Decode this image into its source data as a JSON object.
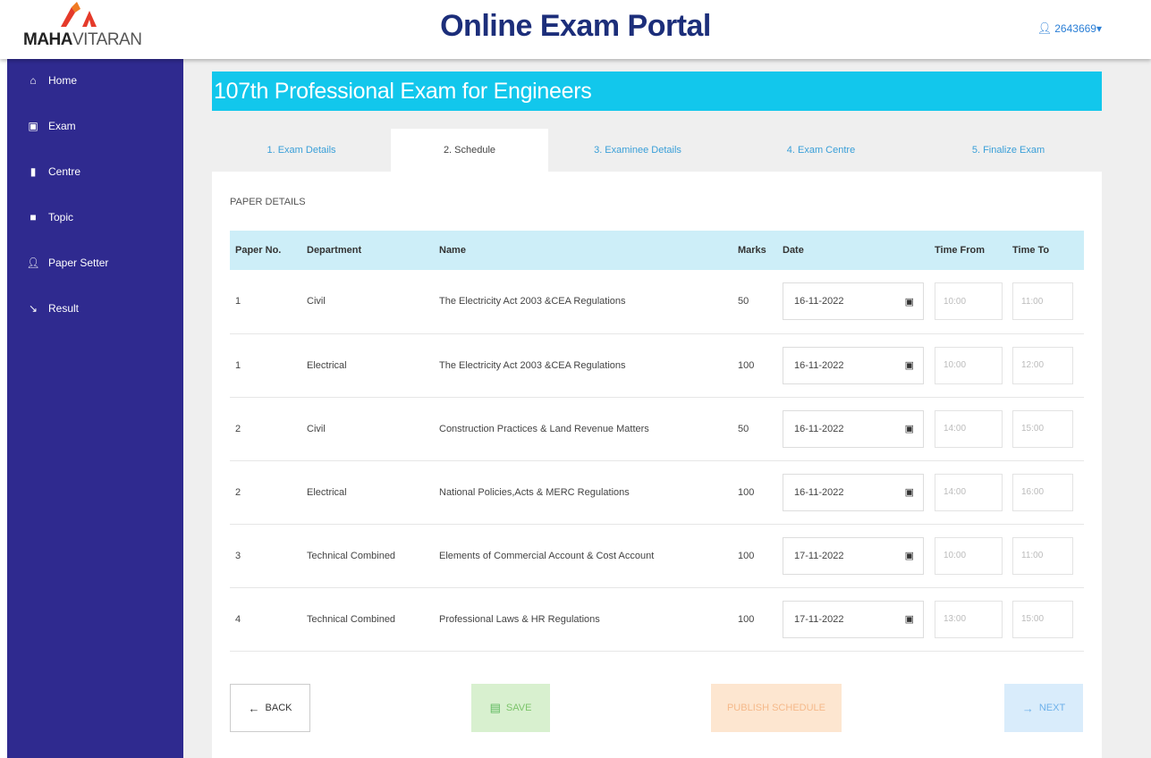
{
  "header": {
    "logo_bold": "MAHA",
    "logo_thin": "VITARAN",
    "title": "Online Exam Portal",
    "user_id": "2643669",
    "user_caret": "▾"
  },
  "sidebar": {
    "items": [
      {
        "label": "Home",
        "icon": "home-icon"
      },
      {
        "label": "Exam",
        "icon": "monitor-icon"
      },
      {
        "label": "Centre",
        "icon": "building-icon"
      },
      {
        "label": "Topic",
        "icon": "book-icon"
      },
      {
        "label": "Paper Setter",
        "icon": "user-icon"
      },
      {
        "label": "Result",
        "icon": "chart-icon"
      }
    ]
  },
  "exam": {
    "title": "107th Professional Exam for Engineers"
  },
  "tabs": [
    {
      "label": "1. Exam Details"
    },
    {
      "label": "2. Schedule"
    },
    {
      "label": "3. Examinee Details"
    },
    {
      "label": "4. Exam Centre"
    },
    {
      "label": "5. Finalize Exam"
    }
  ],
  "paper_details": {
    "section_label": "PAPER DETAILS",
    "columns": [
      "Paper No.",
      "Department",
      "Name",
      "Marks",
      "Date",
      "Time From",
      "Time To"
    ],
    "rows": [
      {
        "paper_no": "1",
        "department": "Civil",
        "name": "The Electricity Act 2003 &CEA Regulations",
        "marks": "50",
        "date": "16-11-2022",
        "time_from": "10:00",
        "time_to": "11:00"
      },
      {
        "paper_no": "1",
        "department": "Electrical",
        "name": "The Electricity Act 2003 &CEA Regulations",
        "marks": "100",
        "date": "16-11-2022",
        "time_from": "10:00",
        "time_to": "12:00"
      },
      {
        "paper_no": "2",
        "department": "Civil",
        "name": "Construction Practices & Land Revenue Matters",
        "marks": "50",
        "date": "16-11-2022",
        "time_from": "14:00",
        "time_to": "15:00"
      },
      {
        "paper_no": "2",
        "department": "Electrical",
        "name": "National Policies,Acts & MERC Regulations",
        "marks": "100",
        "date": "16-11-2022",
        "time_from": "14:00",
        "time_to": "16:00"
      },
      {
        "paper_no": "3",
        "department": "Technical Combined",
        "name": "Elements of Commercial Account & Cost Account",
        "marks": "100",
        "date": "17-11-2022",
        "time_from": "10:00",
        "time_to": "11:00"
      },
      {
        "paper_no": "4",
        "department": "Technical Combined",
        "name": "Professional Laws & HR Regulations",
        "marks": "100",
        "date": "17-11-2022",
        "time_from": "13:00",
        "time_to": "15:00"
      }
    ]
  },
  "buttons": {
    "back": "BACK",
    "save": "SAVE",
    "publish": "PUBLISH SCHEDULE",
    "next": "NEXT"
  },
  "colors": {
    "sidebar": "#2f2a8f",
    "banner": "#12c7ec",
    "title": "#1c2e7a",
    "table_header": "#cdeef8"
  }
}
